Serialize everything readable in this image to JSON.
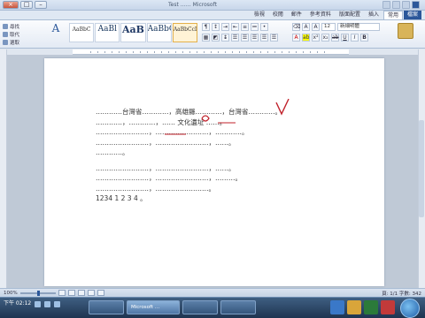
{
  "window": {
    "title": "Test …… Microsoft",
    "controls": [
      "×",
      "□",
      "–"
    ]
  },
  "ribbon": {
    "tabs": [
      {
        "label": "檔案",
        "type": "file"
      },
      {
        "label": "常用",
        "type": "active"
      },
      {
        "label": "插入",
        "type": ""
      },
      {
        "label": "版面配置",
        "type": ""
      },
      {
        "label": "參考資料",
        "type": ""
      },
      {
        "label": "郵件",
        "type": ""
      },
      {
        "label": "校閱",
        "type": ""
      },
      {
        "label": "檢視",
        "type": ""
      }
    ],
    "styles": [
      {
        "label": "AaBbC",
        "size": "small",
        "active": false
      },
      {
        "label": "AaBl",
        "size": "normal",
        "active": false
      },
      {
        "label": "AaB",
        "size": "big",
        "active": false
      },
      {
        "label": "AaBbC",
        "size": "normal",
        "active": false
      },
      {
        "label": "AaBbCcDd",
        "size": "small",
        "active": true
      }
    ],
    "font_name": "新細明體",
    "font_size": "12",
    "right_tools": [
      "尋找",
      "取代",
      "選取"
    ],
    "change_styles_glyph": "A"
  },
  "document": {
    "lines": [
      "…………台灣省…………，高雄縣…………，台灣省…………。",
      "…………，…………，…… 文化遺址 ……。",
      "……………………，……………………，…………。",
      "……………………，……………………，……。",
      "…………。",
      "",
      "……………………，……………………，……。",
      "……………………，……………………，………。",
      "……………………，……………………。",
      "1234 1 2 3 4 。"
    ]
  },
  "status": {
    "zoom": "100%",
    "words": "頁: 1/1  字數: 342"
  },
  "taskbar": {
    "clock": "下午 02:12",
    "date": "",
    "buttons": [
      {
        "label": "",
        "active": false
      },
      {
        "label": "Microsoft …",
        "active": true
      },
      {
        "label": "",
        "active": false
      },
      {
        "label": "",
        "active": false
      }
    ],
    "pinned_colors": [
      "#3a78c8",
      "#d9a53a",
      "#2b7a3a",
      "#c23a3a"
    ]
  }
}
